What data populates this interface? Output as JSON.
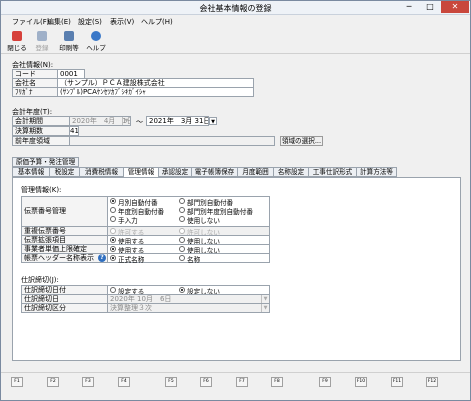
{
  "window": {
    "title": "会社基本情報の登録",
    "minimize": "─",
    "maximize": "□",
    "close": "✕"
  },
  "menu": [
    "ファイル(F)",
    "編集(E)",
    "設定(S)",
    "表示(V)",
    "ヘルプ(H)"
  ],
  "toolbar": {
    "close": "閉じる",
    "register": "登録",
    "print": "印刷等",
    "help": "ヘルプ",
    "close_color": "#d6403a",
    "register_color": "#9fb0c8",
    "print_color": "#5a7fb0",
    "help_color": "#3a78c8"
  },
  "company": {
    "section": "会社情報(N):",
    "code_label": "コード",
    "code_value": "0001",
    "name_label": "会社名",
    "name_value": "（サンプル）ＰＣＡ建設株式会社",
    "kana_label": "ﾌﾘｶﾞﾅ",
    "kana_value": "(ｻﾝﾌﾟﾙ)PCAｹﾝｾﾂｶﾌﾞｼｷｶﾞｲｼｬ"
  },
  "fiscal": {
    "section": "会計年度(T):",
    "period_label": "会計期間",
    "start_date": "2020年　4月　1日",
    "tilde": "～",
    "end_date": "2021年　3月 31日",
    "term_label": "決算期数",
    "term_value": "41",
    "prev_label": "前年度領域",
    "prev_button": "領域の選択..."
  },
  "tabs_row1": [
    "原価予算・発注管理"
  ],
  "tabs_row2": [
    "基本情報",
    "税設定",
    "消費税情報",
    "管理情報",
    "承認設定",
    "電子帳簿保存",
    "月度範囲",
    "名称設定",
    "工事仕訳形式",
    "計算方法等"
  ],
  "management": {
    "section": "管理情報(K):",
    "voucher_label": "伝票番号管理",
    "voucher_options": [
      "月別自動付番",
      "部門別自動付番",
      "年度別自動付番",
      "部門別年度別自動付番",
      "手入力",
      "使用しない"
    ],
    "dup_label": "重複伝票番号",
    "dup_options": [
      "許可する",
      "許可しない"
    ],
    "ext_label": "伝票拡張項目",
    "ext_options": [
      "使用する",
      "使用しない"
    ],
    "limit_label": "事業者単価上限確定",
    "limit_options": [
      "使用する",
      "使用しない"
    ],
    "header_label": "帳票ヘッダー名称表示",
    "header_options": [
      "正式名称",
      "名称"
    ]
  },
  "closing": {
    "section": "仕訳締切(J):",
    "date_label": "仕訳締切日付",
    "date_options": [
      "設定する",
      "設定しない"
    ],
    "day_label": "仕訳締切日",
    "day_value": "2020年 10月　6日",
    "type_label": "仕訳締切区分",
    "type_value": "決算整理３次"
  },
  "fkeys": [
    "F1",
    "F2",
    "F3",
    "F4",
    "F5",
    "F6",
    "F7",
    "F8",
    "F9",
    "F10",
    "F11",
    "F12"
  ]
}
